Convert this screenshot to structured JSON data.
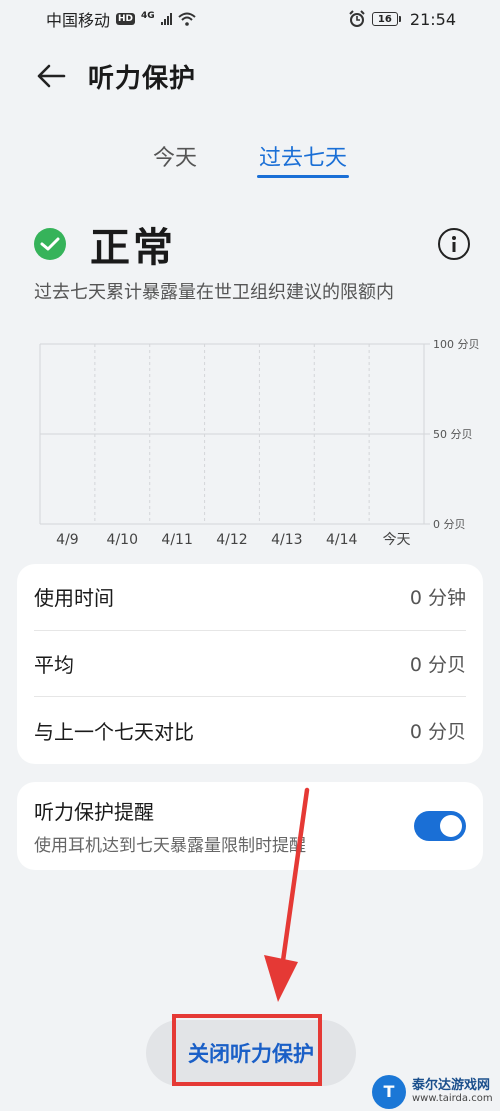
{
  "status_bar": {
    "carrier": "中国移动",
    "hd": "HD",
    "network": "4G",
    "battery": "16",
    "time": "21:54"
  },
  "header": {
    "title": "听力保护"
  },
  "tabs": [
    {
      "label": "今天",
      "active": false
    },
    {
      "label": "过去七天",
      "active": true
    }
  ],
  "status": {
    "word": "正常",
    "description": "过去七天累计暴露量在世卫组织建议的限额内"
  },
  "chart_data": {
    "type": "bar",
    "categories": [
      "4/9",
      "4/10",
      "4/11",
      "4/12",
      "4/13",
      "4/14",
      "今天"
    ],
    "values": [
      0,
      0,
      0,
      0,
      0,
      0,
      0
    ],
    "y_ticks": [
      "100 分贝",
      "50 分贝",
      "0 分贝"
    ],
    "ylim": [
      0,
      100
    ],
    "grid": true
  },
  "stats": [
    {
      "label": "使用时间",
      "value": "0 分钟"
    },
    {
      "label": "平均",
      "value": "0 分贝"
    },
    {
      "label": "与上一个七天对比",
      "value": "0 分贝"
    }
  ],
  "reminder": {
    "title": "听力保护提醒",
    "subtitle": "使用耳机达到七天暴露量限制时提醒",
    "enabled": true
  },
  "close_button": {
    "label": "关闭听力保护"
  },
  "watermark": {
    "name": "泰尔达游戏网",
    "url": "www.tairda.com",
    "logo_letter": "T"
  },
  "colors": {
    "accent": "#1a6fd6",
    "ok": "#36b35a",
    "annotation": "#e53935"
  }
}
